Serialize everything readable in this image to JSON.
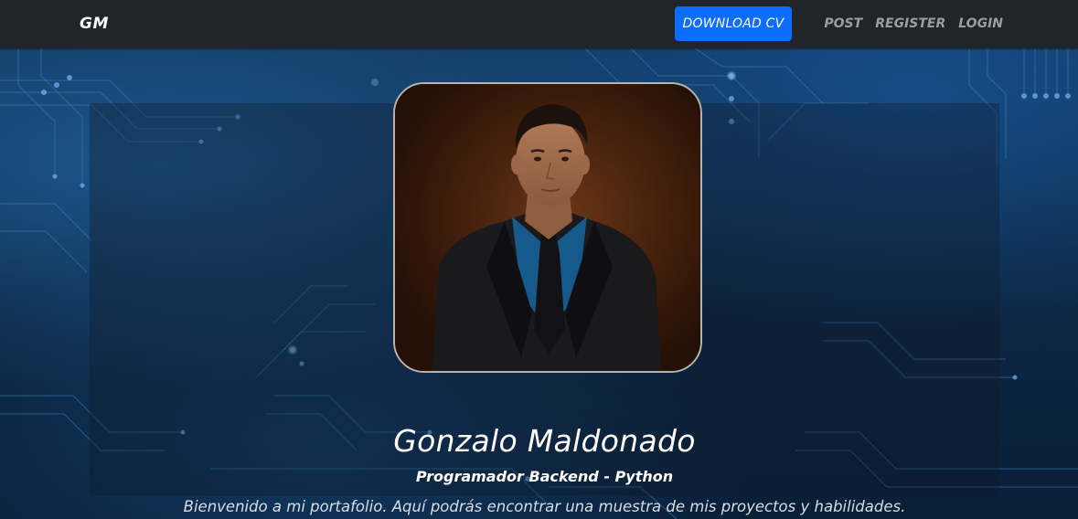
{
  "navbar": {
    "brand": "GM",
    "download_cv": "DOWNLOAD CV",
    "links": [
      "POST",
      "REGISTER",
      "LOGIN"
    ]
  },
  "hero": {
    "name": "Gonzalo Maldonado",
    "role": "Programador Backend - Python",
    "description": "Bienvenido a mi portafolio. Aquí podrás encontrar una muestra de mis proyectos y habilidades."
  },
  "colors": {
    "navbar_bg": "#212529",
    "primary_button": "#0d6efd",
    "nav_link": "#9a9da2",
    "hero_bg": "#0c2642"
  },
  "icons": {
    "profile": "profile-photo"
  }
}
